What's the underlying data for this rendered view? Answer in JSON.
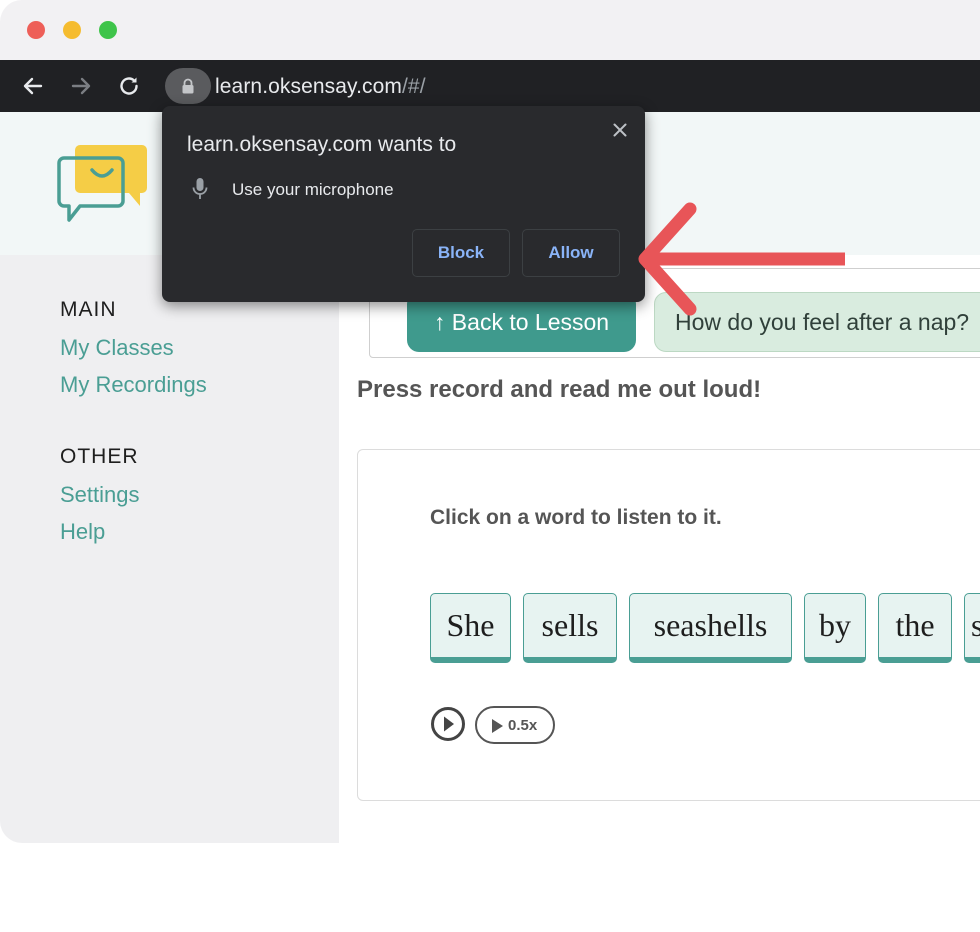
{
  "browser": {
    "url_host": "learn.oksensay.com",
    "url_path": "/#/"
  },
  "sidebar": {
    "main_heading": "MAIN",
    "main_items": [
      {
        "label": "My Classes"
      },
      {
        "label": "My Recordings"
      }
    ],
    "other_heading": "OTHER",
    "other_items": [
      {
        "label": "Settings"
      },
      {
        "label": "Help"
      }
    ]
  },
  "lesson": {
    "back_label": "↑ Back to Lesson",
    "question": "How do you feel after a nap?"
  },
  "instruction": "Press record and read me out loud!",
  "reader": {
    "hint": "Click on a word to listen to it.",
    "words": [
      "She",
      "sells",
      "seashells",
      "by",
      "the",
      "sea"
    ],
    "slow_label": "0.5x"
  },
  "permission_popup": {
    "title": "learn.oksensay.com wants to",
    "permission": "Use your microphone",
    "block_label": "Block",
    "allow_label": "Allow"
  },
  "colors": {
    "accent_teal": "#4a9e94",
    "annotation_arrow": "#e85558",
    "popup_bg": "#292a2d",
    "popup_button_text": "#8ab4f8"
  }
}
